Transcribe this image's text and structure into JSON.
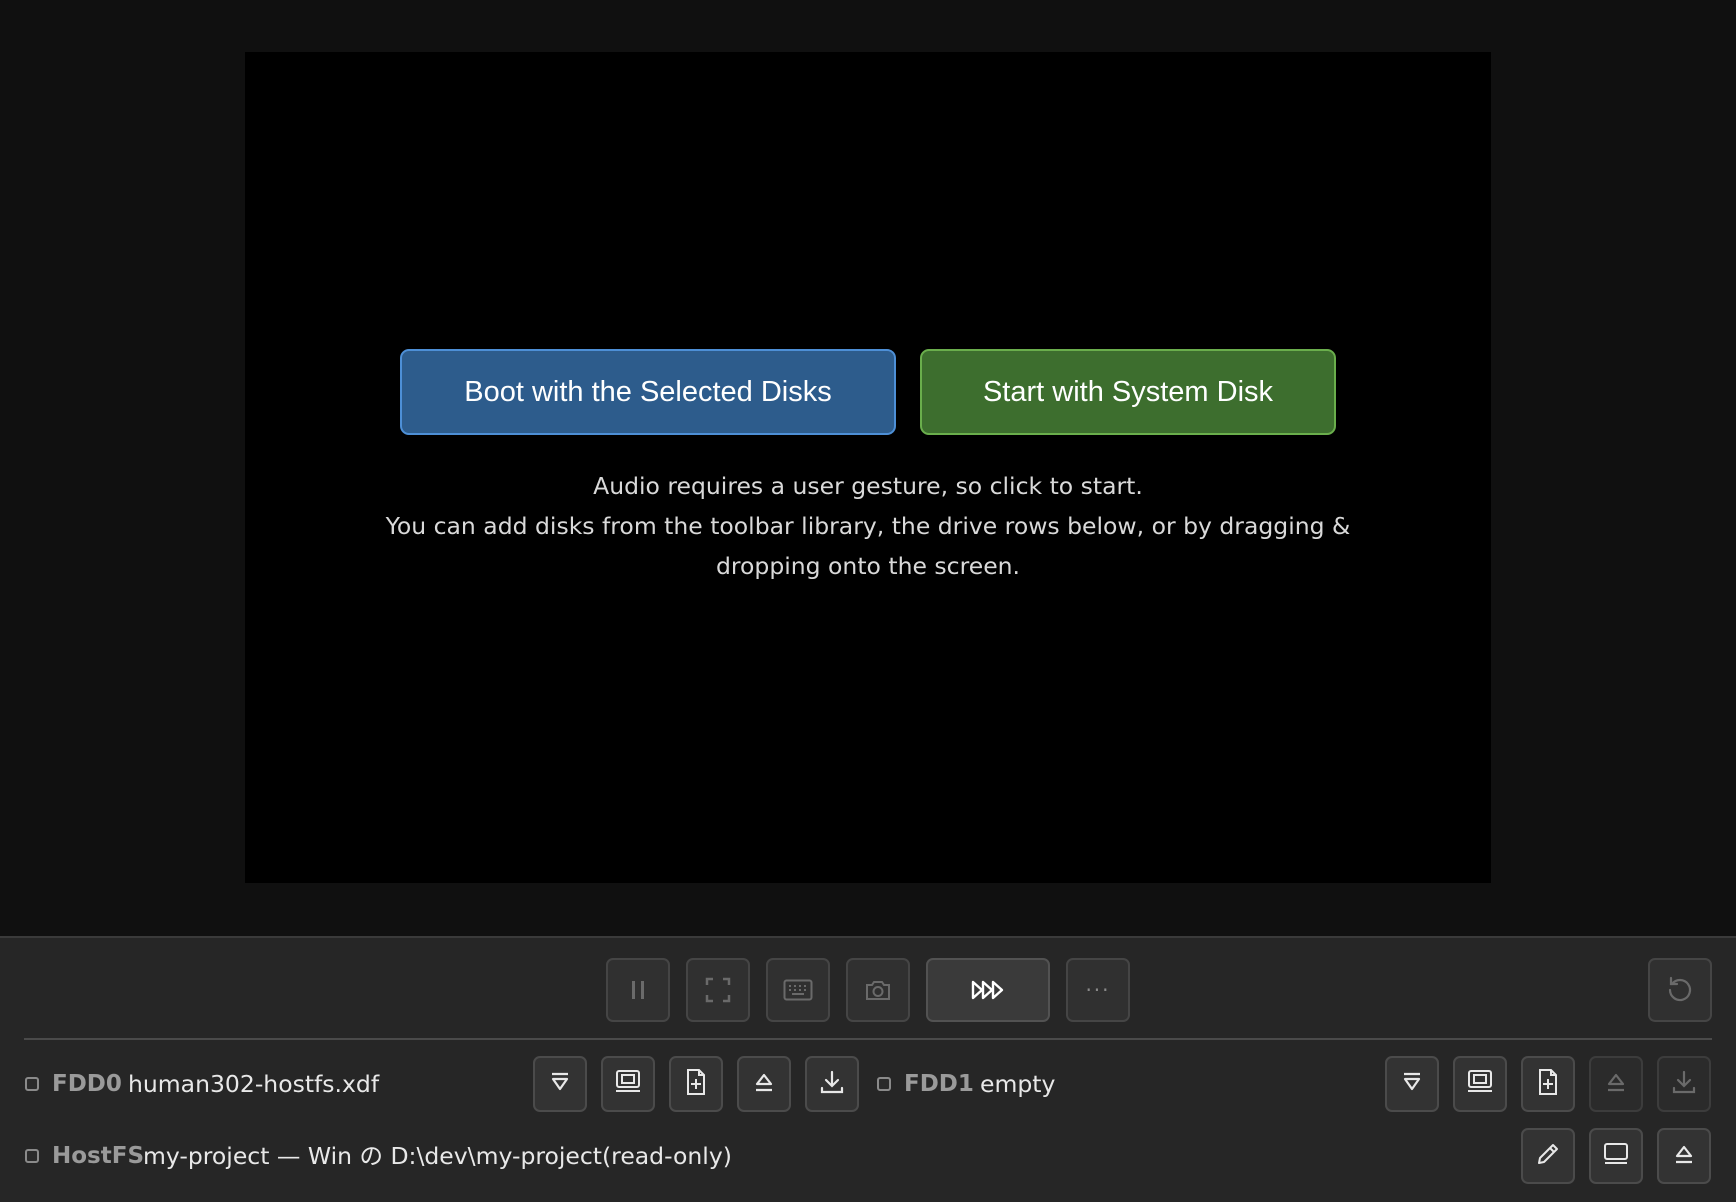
{
  "screen": {
    "boot_selected_label": "Boot with the Selected Disks",
    "start_system_label": "Start with System Disk",
    "message_lines": [
      "Audio requires a user gesture, so click to start.",
      "You can add disks from the toolbar library, the drive rows below, or by dragging &",
      "dropping onto the screen."
    ]
  },
  "toolbar": {
    "buttons": [
      "pause-icon",
      "fullscreen-icon",
      "keyboard-icon",
      "camera-icon",
      "fast-forward-icon",
      "more-icon"
    ],
    "more_label": "···",
    "reset_icon": "reset-icon"
  },
  "drives": {
    "fdd0": {
      "label": "FDD0",
      "file": "human302-hostfs.xdf",
      "checked": false
    },
    "fdd1": {
      "label": "FDD1",
      "file": "empty",
      "checked": false
    },
    "hostfs": {
      "label": "HostFS",
      "path": "my-project — Win の D:\\dev\\my-project(read-only)",
      "checked": false
    }
  },
  "colors": {
    "boot_button": "#2d5c8c",
    "start_button": "#3d6e2e",
    "panel_bg": "#262626"
  }
}
